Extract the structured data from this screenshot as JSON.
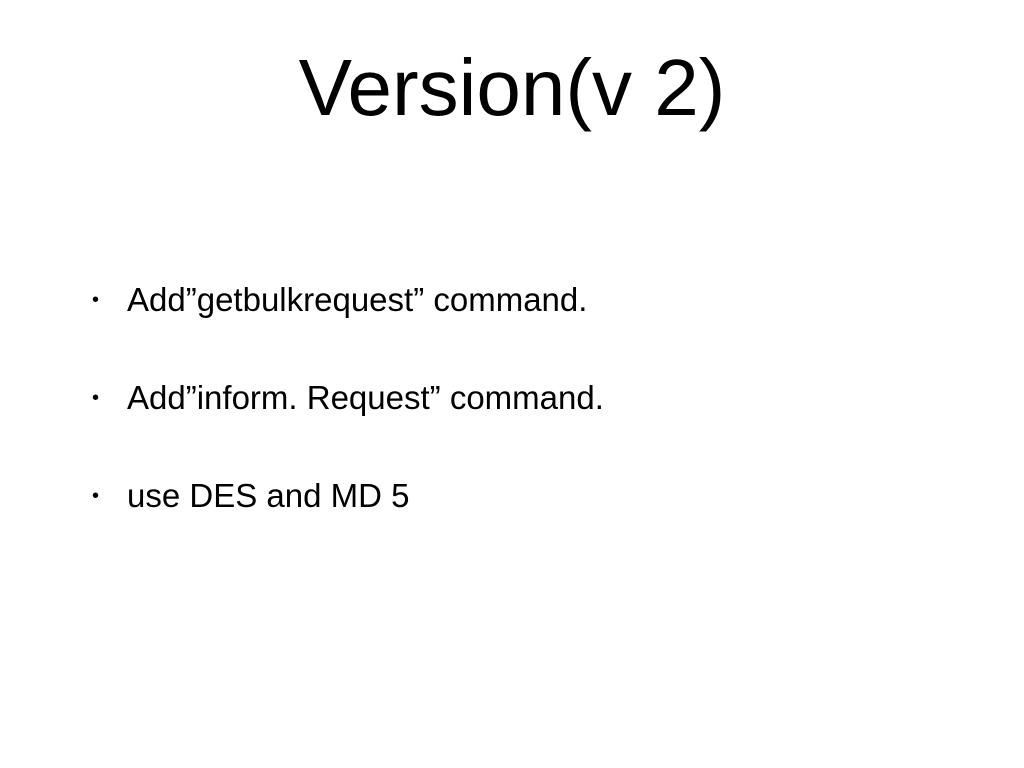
{
  "title": "Version(v 2)",
  "bullets": [
    "Add”getbulkrequest” command.",
    "Add”inform. Request” command.",
    "use DES and MD 5"
  ],
  "bullet_glyph": "•"
}
